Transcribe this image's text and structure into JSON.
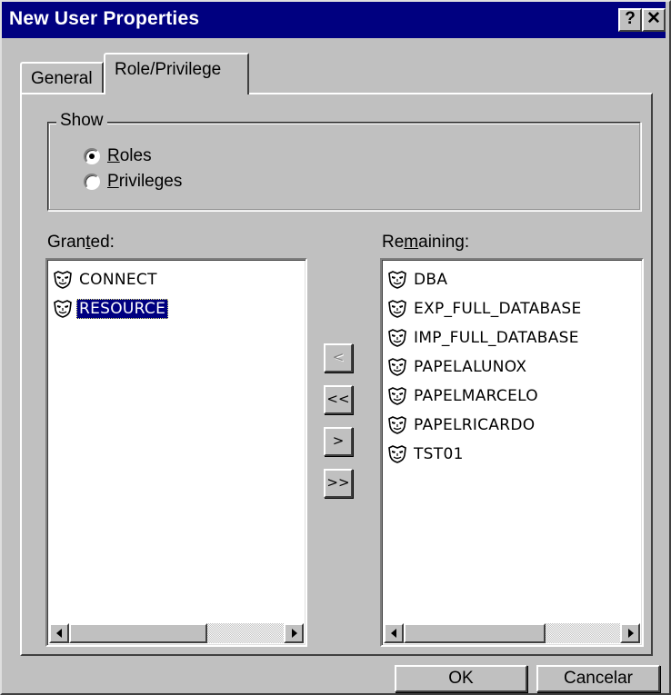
{
  "window": {
    "title": "New User Properties",
    "help_label": "?",
    "close_label": "✕"
  },
  "tabs": [
    {
      "label": "General",
      "active": false
    },
    {
      "label": "Role/Privilege",
      "active": true
    }
  ],
  "show_group": {
    "label": "Show",
    "options": [
      {
        "label": "Roles",
        "accel": "R",
        "rest": "oles",
        "checked": true
      },
      {
        "label": "Privileges",
        "accel": "P",
        "rest": "rivileges",
        "checked": false
      }
    ]
  },
  "granted": {
    "label_pre": "Gran",
    "label_accel": "t",
    "label_post": "ed:",
    "items": [
      {
        "label": "CONNECT",
        "icon": "role-mask-icon",
        "selected": false
      },
      {
        "label": "RESOURCE",
        "icon": "role-mask-icon",
        "selected": true
      }
    ]
  },
  "remaining": {
    "label_pre": "Re",
    "label_accel": "m",
    "label_post": "aining:",
    "items": [
      {
        "label": "DBA",
        "icon": "role-mask-icon"
      },
      {
        "label": "EXP_FULL_DATABASE",
        "icon": "role-mask-icon"
      },
      {
        "label": "IMP_FULL_DATABASE",
        "icon": "role-mask-icon"
      },
      {
        "label": "PAPELALUNOX",
        "icon": "role-mask-icon"
      },
      {
        "label": "PAPELMARCELO",
        "icon": "role-mask-icon"
      },
      {
        "label": "PAPELRICARDO",
        "icon": "role-mask-icon"
      },
      {
        "label": "TST01",
        "icon": "role-mask-icon"
      }
    ]
  },
  "move_buttons": [
    {
      "label": "<",
      "enabled": false
    },
    {
      "label": "<<",
      "enabled": true
    },
    {
      "label": ">",
      "enabled": true
    },
    {
      "label": ">>",
      "enabled": true
    }
  ],
  "buttons": {
    "ok": "OK",
    "cancel": "Cancelar"
  }
}
